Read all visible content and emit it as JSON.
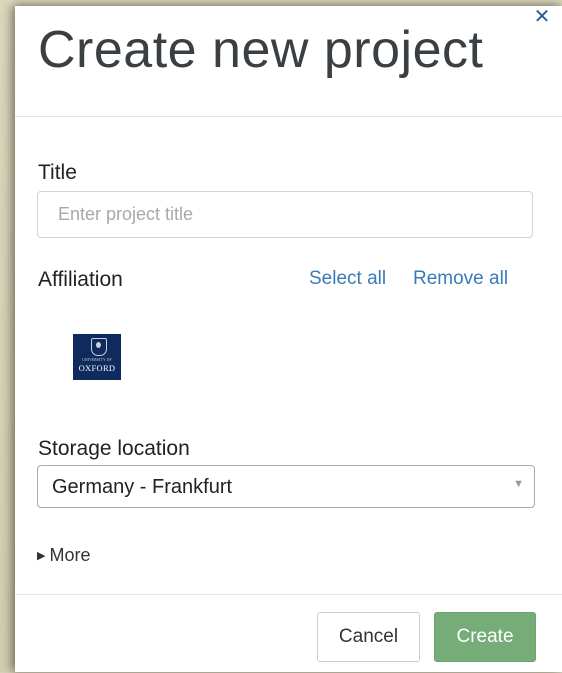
{
  "dialog": {
    "title": "Create new project",
    "close_icon": "close-icon"
  },
  "title_field": {
    "label": "Title",
    "value": "",
    "placeholder": "Enter project title"
  },
  "affiliation": {
    "label": "Affiliation",
    "select_all": "Select all",
    "remove_all": "Remove all",
    "logos": [
      {
        "name": "university-of-oxford-logo",
        "small_text": "UNIVERSITY OF",
        "main_text": "OXFORD",
        "color": "#0f2a5c"
      }
    ]
  },
  "storage": {
    "label": "Storage location",
    "selected": "Germany - Frankfurt"
  },
  "more": {
    "label": "More"
  },
  "footer": {
    "cancel_label": "Cancel",
    "create_label": "Create"
  },
  "colors": {
    "link": "#3a7ab8",
    "create_button": "#76ac78",
    "close_icon": "#2a5d9a"
  }
}
